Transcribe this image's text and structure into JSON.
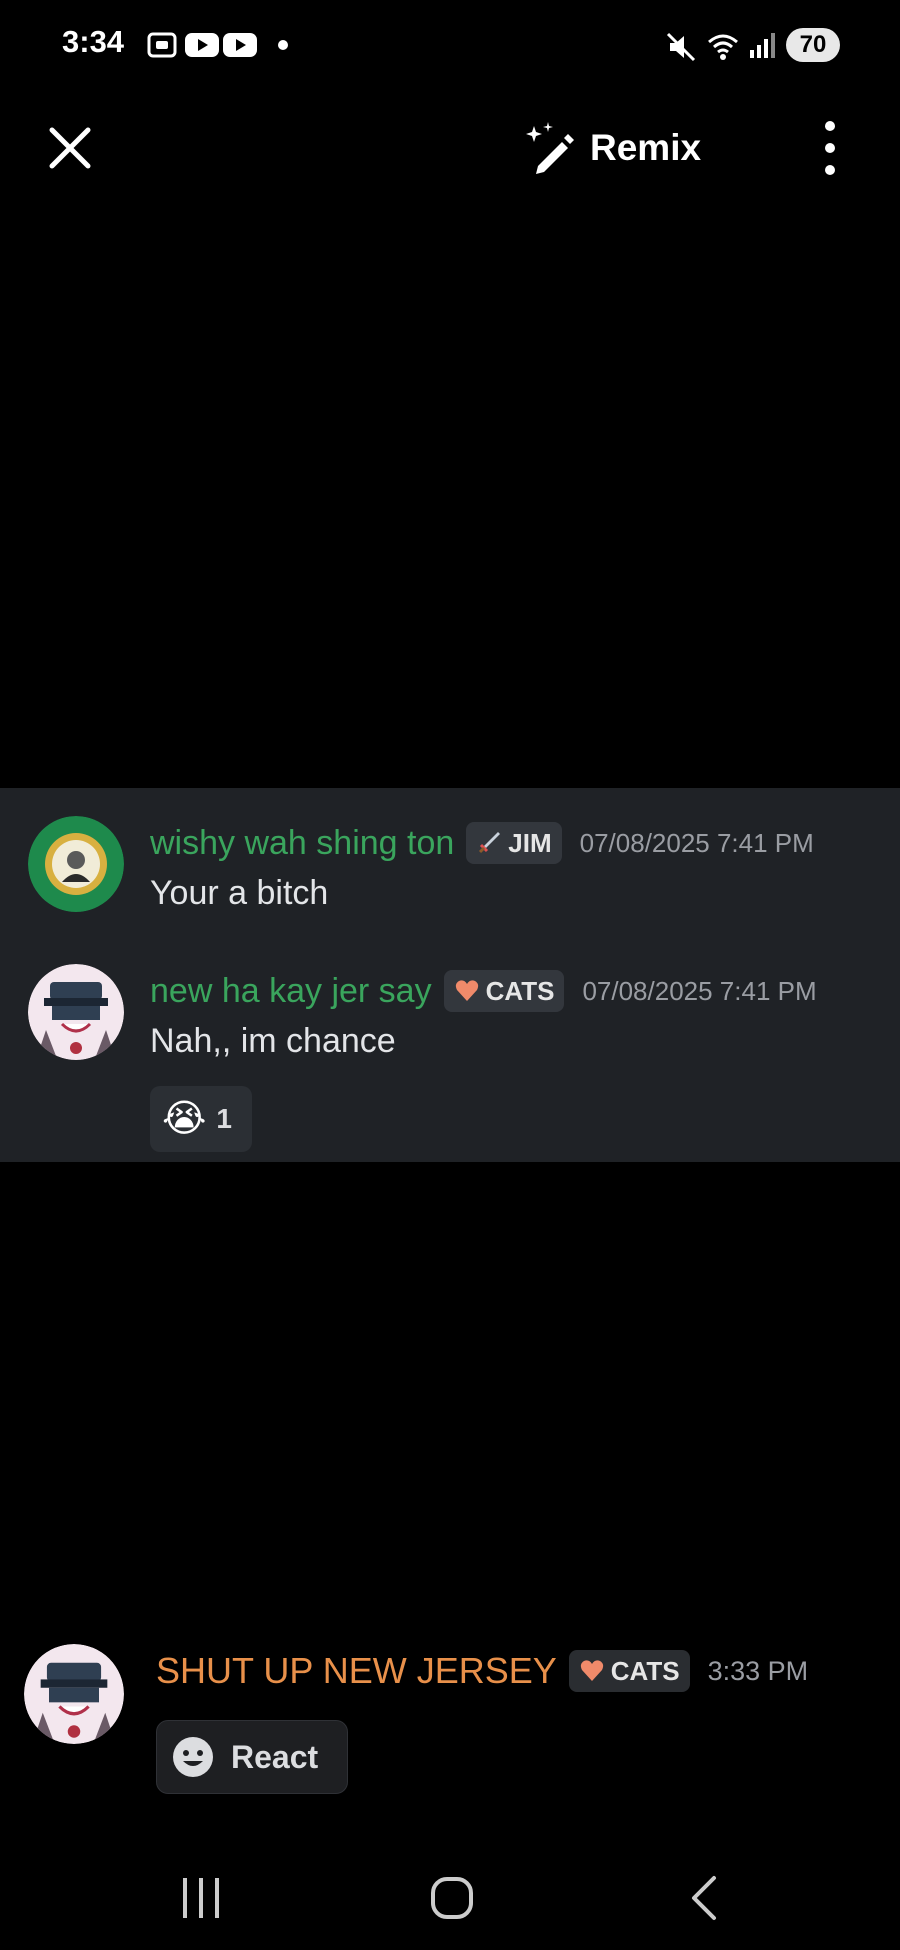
{
  "status_bar": {
    "time": "3:34",
    "battery": "70",
    "icons": [
      "screenshot-icon",
      "youtube-icon",
      "youtube-icon",
      "dot-icon",
      "mute-icon",
      "wifi-icon",
      "signal-icon"
    ]
  },
  "top_bar": {
    "remix_label": "Remix"
  },
  "messages": [
    {
      "username": "wishy wah shing ton",
      "tag": "JIM",
      "tag_icon": "sword-icon",
      "timestamp": "07/08/2025 7:41 PM",
      "text": "Your a bitch",
      "avatar": "washington-seal-avatar"
    },
    {
      "username": "new ha kay jer say",
      "tag": "CATS",
      "tag_icon": "heart-icon",
      "timestamp": "07/08/2025 7:41 PM",
      "text": "Nah,, im chance",
      "avatar": "cartoon-avatar",
      "reaction": {
        "emoji": "😭",
        "count": "1"
      }
    }
  ],
  "bottom_author": {
    "username": "SHUT UP NEW JERSEY",
    "tag": "CATS",
    "timestamp": "3:33 PM",
    "react_label": "React"
  },
  "colors": {
    "username_green": "#3aa55d",
    "username_orange": "#e8904a",
    "card_bg": "#1f2226",
    "tag_bg": "#33373d"
  }
}
